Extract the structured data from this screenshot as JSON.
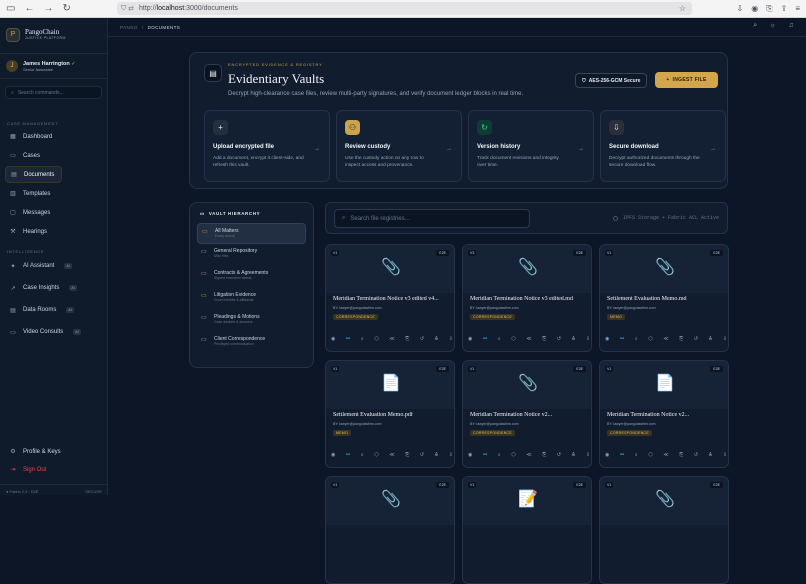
{
  "browser": {
    "url_prefix": "http://",
    "url_host": "localhost",
    "url_path": ":3000/documents"
  },
  "brand": {
    "name": "PangoChain",
    "sub": "JUSTICE PLATFORM",
    "logo": "P"
  },
  "user": {
    "initial": "J",
    "name": "James Harrington",
    "role": "Senior Associate"
  },
  "sidebar": {
    "search_placeholder": "Search commands...",
    "section_case": "CASE MANAGEMENT",
    "items": [
      {
        "label": "Dashboard",
        "icon": "grid-icon",
        "glyph": "▦"
      },
      {
        "label": "Cases",
        "icon": "folder-icon",
        "glyph": "▭"
      },
      {
        "label": "Documents",
        "icon": "document-icon",
        "glyph": "▤"
      },
      {
        "label": "Templates",
        "icon": "template-icon",
        "glyph": "▥"
      },
      {
        "label": "Messages",
        "icon": "message-icon",
        "glyph": "▢"
      },
      {
        "label": "Hearings",
        "icon": "gavel-icon",
        "glyph": "⚒"
      }
    ],
    "section_intel": "INTELLIGENCE",
    "intel": [
      {
        "label": "AI Assistant",
        "icon": "sparkle-icon",
        "glyph": "✦",
        "badge": "AI"
      },
      {
        "label": "Case Insights",
        "icon": "trend-icon",
        "glyph": "↗",
        "badge": "AI"
      },
      {
        "label": "Data Rooms",
        "icon": "database-icon",
        "glyph": "▤",
        "badge": "AI"
      },
      {
        "label": "Video Consults",
        "icon": "video-icon",
        "glyph": "▭",
        "badge": "AI"
      }
    ],
    "profile": "Profile & Keys",
    "signout": "Sign Out",
    "fabric": "● Fabric 2.4 · E2E",
    "fabric_right": "SECURE"
  },
  "topbar": {
    "crumb1": "PANGO",
    "sep": "/",
    "crumb2": "DOCUMENTS"
  },
  "hero": {
    "kicker": "ENCRYPTED EVIDENCE & REGISTRY",
    "title": "Evidentiary Vaults",
    "desc": "Decrypt high-clearance case files, review multi-party signatures, and verify document ledger blocks in real time.",
    "aes": "AES-256-GCM Secure",
    "ingest": "INGEST FILE",
    "cards": [
      {
        "title": "Upload encrypted file",
        "desc": "Add a document, encrypt it client-side, and refresh this vault.",
        "icon": "plus-icon",
        "glyph": "+",
        "bg": "#252e3c",
        "color": "#e2e8f0"
      },
      {
        "title": "Review custody",
        "desc": "Use the custody action on any row to inspect access and provenance.",
        "icon": "custody-icon",
        "glyph": "⚇",
        "bg": "#c9a44c",
        "color": "#1e1608"
      },
      {
        "title": "Version history",
        "desc": "Track document revisions and integrity over time.",
        "icon": "history-icon",
        "glyph": "↻",
        "bg": "#0f3b33",
        "color": "#34d399"
      },
      {
        "title": "Secure download",
        "desc": "Decrypt authorized documents through the secure download flow.",
        "icon": "download-icon",
        "glyph": "⇩",
        "bg": "#2a2f3a",
        "color": "#e2e8f0"
      }
    ]
  },
  "vault": {
    "title": "VAULT HIERARCHY",
    "items": [
      {
        "title": "All Matters",
        "sub": "Every record"
      },
      {
        "title": "General Repository",
        "sub": "Misc files"
      },
      {
        "title": "Contracts & Agreements",
        "sub": "Signed execution deeds"
      },
      {
        "title": "Litigation Evidence",
        "sub": "Court exhibits & affidavits"
      },
      {
        "title": "Pleadings & Motions",
        "sub": "Case dockets & answers"
      },
      {
        "title": "Client Correspondence",
        "sub": "Privileged communication"
      }
    ]
  },
  "registry": {
    "search_placeholder": "Search file registries...",
    "status": "IPFS Storage + Fabric ACL Active"
  },
  "files": [
    {
      "ver": "V1",
      "e2e": "E2E",
      "name": "Meridian Termination Notice v3 edited v4...",
      "by": "BY: lawyer@pangolawfirm.com",
      "tag": "CORRESPONDENCE",
      "icon": "paperclip-icon",
      "glyph": "📎"
    },
    {
      "ver": "V3",
      "e2e": "E2E",
      "name": "Meridian Termination Notice v3 edited.md",
      "by": "BY: lawyer@pangolawfirm.com",
      "tag": "CORRESPONDENCE",
      "icon": "paperclip-icon",
      "glyph": "📎"
    },
    {
      "ver": "V1",
      "e2e": "E2E",
      "name": "Settlement Evaluation Memo.md",
      "by": "BY: lawyer@pangolawfirm.com",
      "tag": "MEMO",
      "icon": "paperclip-icon",
      "glyph": "📎"
    },
    {
      "ver": "V1",
      "e2e": "E2E",
      "name": "Settlement Evaluation Memo.pdf",
      "by": "BY: lawyer@pangolawfirm.com",
      "tag": "MEMO",
      "icon": "page-icon",
      "glyph": "📄"
    },
    {
      "ver": "V1",
      "e2e": "E2E",
      "name": "Meridian Termination Notice v2...",
      "by": "BY: lawyer@pangolawfirm.com",
      "tag": "CORRESPONDENCE",
      "icon": "paperclip-icon",
      "glyph": "📎"
    },
    {
      "ver": "V1",
      "e2e": "E2E",
      "name": "Meridian Termination Notice v2...",
      "by": "BY: lawyer@pangolawfirm.com",
      "tag": "CORRESPONDENCE",
      "icon": "page-icon",
      "glyph": "📄"
    },
    {
      "ver": "V1",
      "e2e": "E2E",
      "name": "",
      "by": "",
      "tag": "",
      "icon": "paperclip-icon",
      "glyph": "📎"
    },
    {
      "ver": "V1",
      "e2e": "E2E",
      "name": "",
      "by": "",
      "tag": "",
      "icon": "note-icon",
      "glyph": "📝"
    },
    {
      "ver": "V1",
      "e2e": "E2E",
      "name": "",
      "by": "",
      "tag": "",
      "icon": "paperclip-icon",
      "glyph": "📎"
    }
  ],
  "file_actions": [
    "◉",
    "⚯",
    "⌕",
    "⬡",
    "≪",
    "⎘",
    "↺",
    "Ѧ",
    "⇩"
  ]
}
